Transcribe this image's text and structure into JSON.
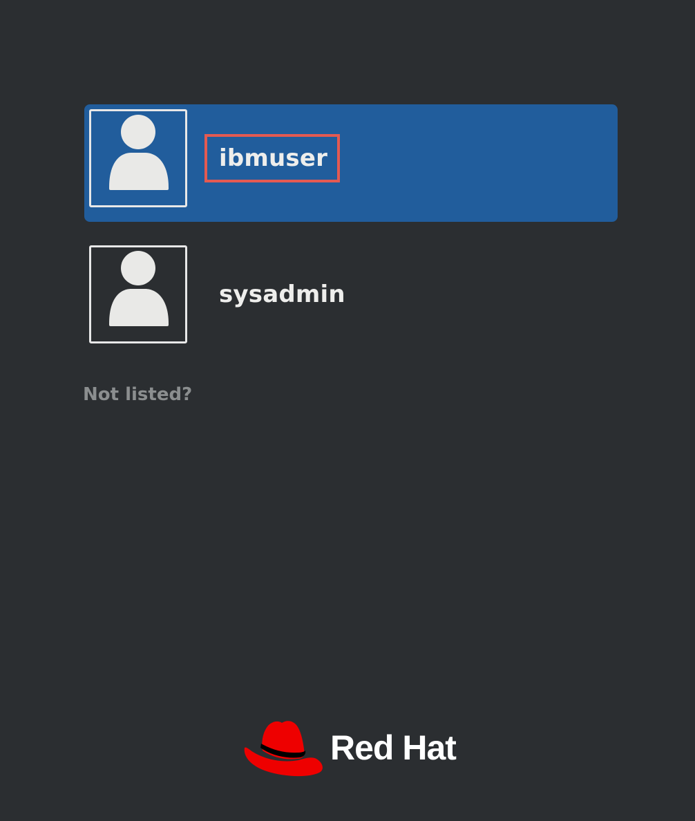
{
  "users": [
    {
      "name": "ibmuser",
      "selected": true
    },
    {
      "name": "sysadmin",
      "selected": false
    }
  ],
  "not_listed_label": "Not listed?",
  "logo": {
    "text": "Red Hat",
    "icon": "red-hat-fedora-icon"
  },
  "colors": {
    "background": "#2b2e31",
    "selection": "#215d9c",
    "highlight_box": "#e45a52",
    "logo_red": "#ee0000",
    "text": "#eeeeec",
    "muted_text": "#8b8e8f"
  }
}
